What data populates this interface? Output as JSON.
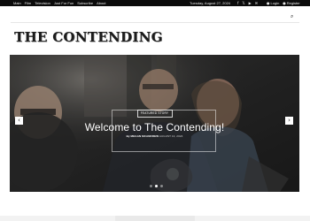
{
  "topbar": {
    "nav": [
      "Main",
      "Film",
      "Television",
      "Just For Fun",
      "Subscribe",
      "About"
    ],
    "date": "Tuesday, August 27, 2024",
    "social_icons": [
      "facebook-icon",
      "x-icon",
      "youtube-icon",
      "mail-icon"
    ],
    "login": "Login",
    "register": "Register"
  },
  "header": {
    "logo_text": "THE CONTENDING"
  },
  "hero": {
    "tag": "FEATURED STORY",
    "title": "Welcome to The Contending!",
    "author": "By MEGAN MCANDREW",
    "date": "AUGUST 13, 2024"
  },
  "carousel": {
    "slides": 3,
    "active_index": 1,
    "prev_icon": "chevron-left-icon",
    "next_icon": "chevron-right-icon"
  },
  "colors": {
    "topbar_bg": "#0b0b0b",
    "topbar_text": "#e9e9e9",
    "logo": "#1c1c1c"
  }
}
